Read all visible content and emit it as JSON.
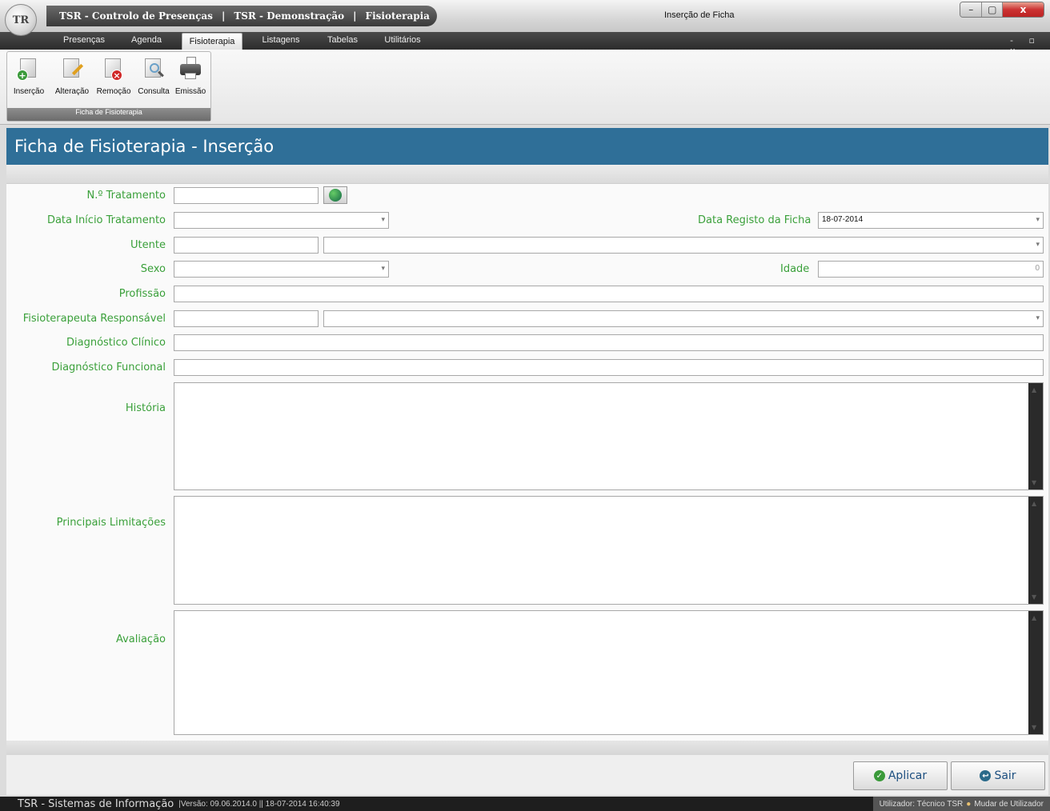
{
  "window": {
    "logo_text": "TR",
    "title_parts": [
      "TSR - Controlo de Presenças",
      "|",
      "TSR - Demonstração",
      "|",
      "Fisioterapia"
    ],
    "title": "Inserção de Ficha",
    "minimize": "–",
    "maximize": "▢",
    "close": "x"
  },
  "tabs": [
    "Presenças",
    "Agenda",
    "Fisioterapia",
    "Listagens",
    "Tabelas",
    "Utilitários"
  ],
  "active_tab": "Fisioterapia",
  "mdi_controls": "- ▫ x",
  "ribbon": {
    "buttons": [
      {
        "label": "Inserção",
        "icon": "document-add-icon"
      },
      {
        "label": "Alteração",
        "icon": "document-edit-icon"
      },
      {
        "label": "Remoção",
        "icon": "document-remove-icon"
      },
      {
        "label": "Consulta",
        "icon": "document-search-icon"
      },
      {
        "label": "Emissão",
        "icon": "printer-icon"
      }
    ],
    "group_caption": "Ficha de Fisioterapia"
  },
  "form": {
    "title": "Ficha de Fisioterapia - Inserção",
    "labels": {
      "n_tratamento": "N.º Tratamento",
      "data_inicio": "Data Início Tratamento",
      "data_registo": "Data Registo da Ficha",
      "utente": "Utente",
      "sexo": "Sexo",
      "idade": "Idade",
      "profissao": "Profissão",
      "fisioterapeuta": "Fisioterapeuta Responsável",
      "diag_clinico": "Diagnóstico Clínico",
      "diag_funcional": "Diagnóstico Funcional",
      "historia": "História",
      "limitacoes": "Principais Limitações",
      "avaliacao": "Avaliação"
    },
    "values": {
      "data_registo": "18-07-2014",
      "idade": "0"
    }
  },
  "buttons": {
    "apply": "Aplicar",
    "exit": "Sair"
  },
  "status": {
    "company": "TSR - Sistemas de Informação",
    "version": "|Versão:  09.06.2014.0 || 18-07-2014 16:40:39",
    "user": "Utilizador: Técnico TSR",
    "change_user": "Mudar de Utilizador"
  },
  "colors": {
    "header": "#2f6f98",
    "label": "#3aa03a"
  }
}
